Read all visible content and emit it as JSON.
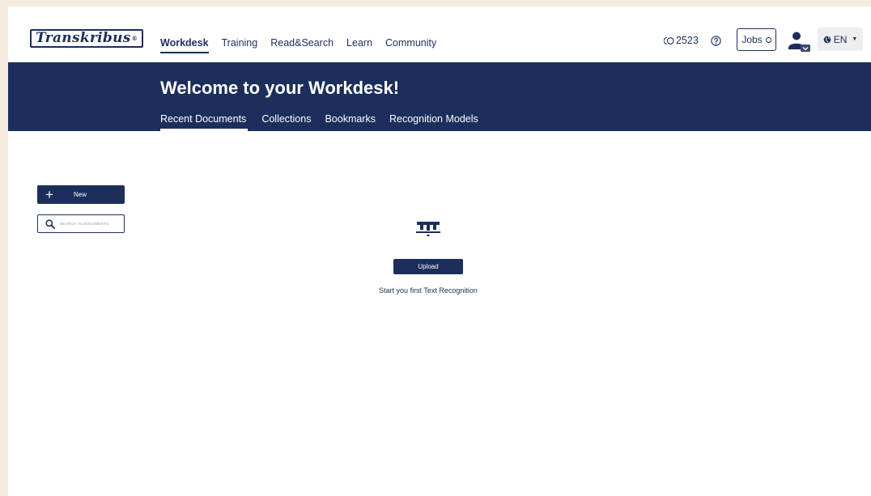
{
  "header": {
    "logo_text": "Transkribus",
    "logo_mark": "®",
    "nav": [
      {
        "label": "Workdesk",
        "active": true
      },
      {
        "label": "Training",
        "active": false
      },
      {
        "label": "Read&Search",
        "active": false
      },
      {
        "label": "Learn",
        "active": false
      },
      {
        "label": "Community",
        "active": false
      }
    ],
    "credits": "2523",
    "credits_icon": "credits-icon",
    "help_icon": "help-icon",
    "jobs_label": "Jobs",
    "user_icon": "user-icon",
    "language": "EN",
    "language_icon": "globe-icon"
  },
  "banner": {
    "title": "Welcome to your Workdesk!",
    "tabs": [
      {
        "label": "Recent Documents",
        "active": true
      },
      {
        "label": "Collections",
        "active": false
      },
      {
        "label": "Bookmarks",
        "active": false
      },
      {
        "label": "Recognition Models",
        "active": false
      }
    ]
  },
  "sidebar": {
    "new_label": "New",
    "search_placeholder": "Search in documents"
  },
  "empty_state": {
    "icon": "transkribus-t-icon",
    "upload_label": "Upload",
    "message": "Start you first Text Recognition"
  },
  "colors": {
    "primary": "#1c2e5c",
    "page_bg": "#f5ecde",
    "surface": "#ffffff"
  }
}
